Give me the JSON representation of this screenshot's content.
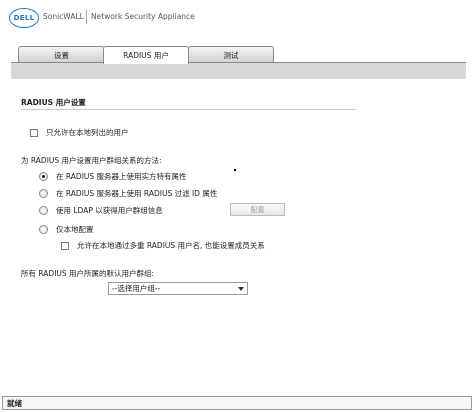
{
  "header": {
    "logo": "DELL",
    "brand": "SonicWALL",
    "product": "Network Security Appliance"
  },
  "tabs": [
    {
      "label": "设置",
      "active": false
    },
    {
      "label": "RADIUS 用户",
      "active": true
    },
    {
      "label": "测试",
      "active": false
    }
  ],
  "section": {
    "title": "RADIUS 用户设置"
  },
  "local_only": {
    "label": "只允许在本地列出的用户",
    "checked": false
  },
  "membership": {
    "prompt": "为 RADIUS 用户设置用户群组关系的方法:",
    "options": [
      {
        "label": "在 RADIUS 服务器上使用实方特有属性",
        "selected": true
      },
      {
        "label": "在 RADIUS 服务器上使用 RADIUS 过滤 ID 属性",
        "selected": false
      },
      {
        "label": "使用 LDAP 以获得用户群组信息",
        "selected": false
      },
      {
        "label": "仅本地配置",
        "selected": false
      }
    ],
    "config_button": "配置",
    "sub_option": {
      "label": "允许在本地通过多重 RADIUS 用户名, 也能设置成员关系",
      "checked": false
    }
  },
  "default_group": {
    "label": "所有 RADIUS 用户所属的默认用户群组:",
    "selected": "--选择用户组--"
  },
  "status_bar": {
    "text": "就绪"
  },
  "colors": {
    "brand_blue": "#1b75bc",
    "band_gray": "#d8d8d8"
  }
}
